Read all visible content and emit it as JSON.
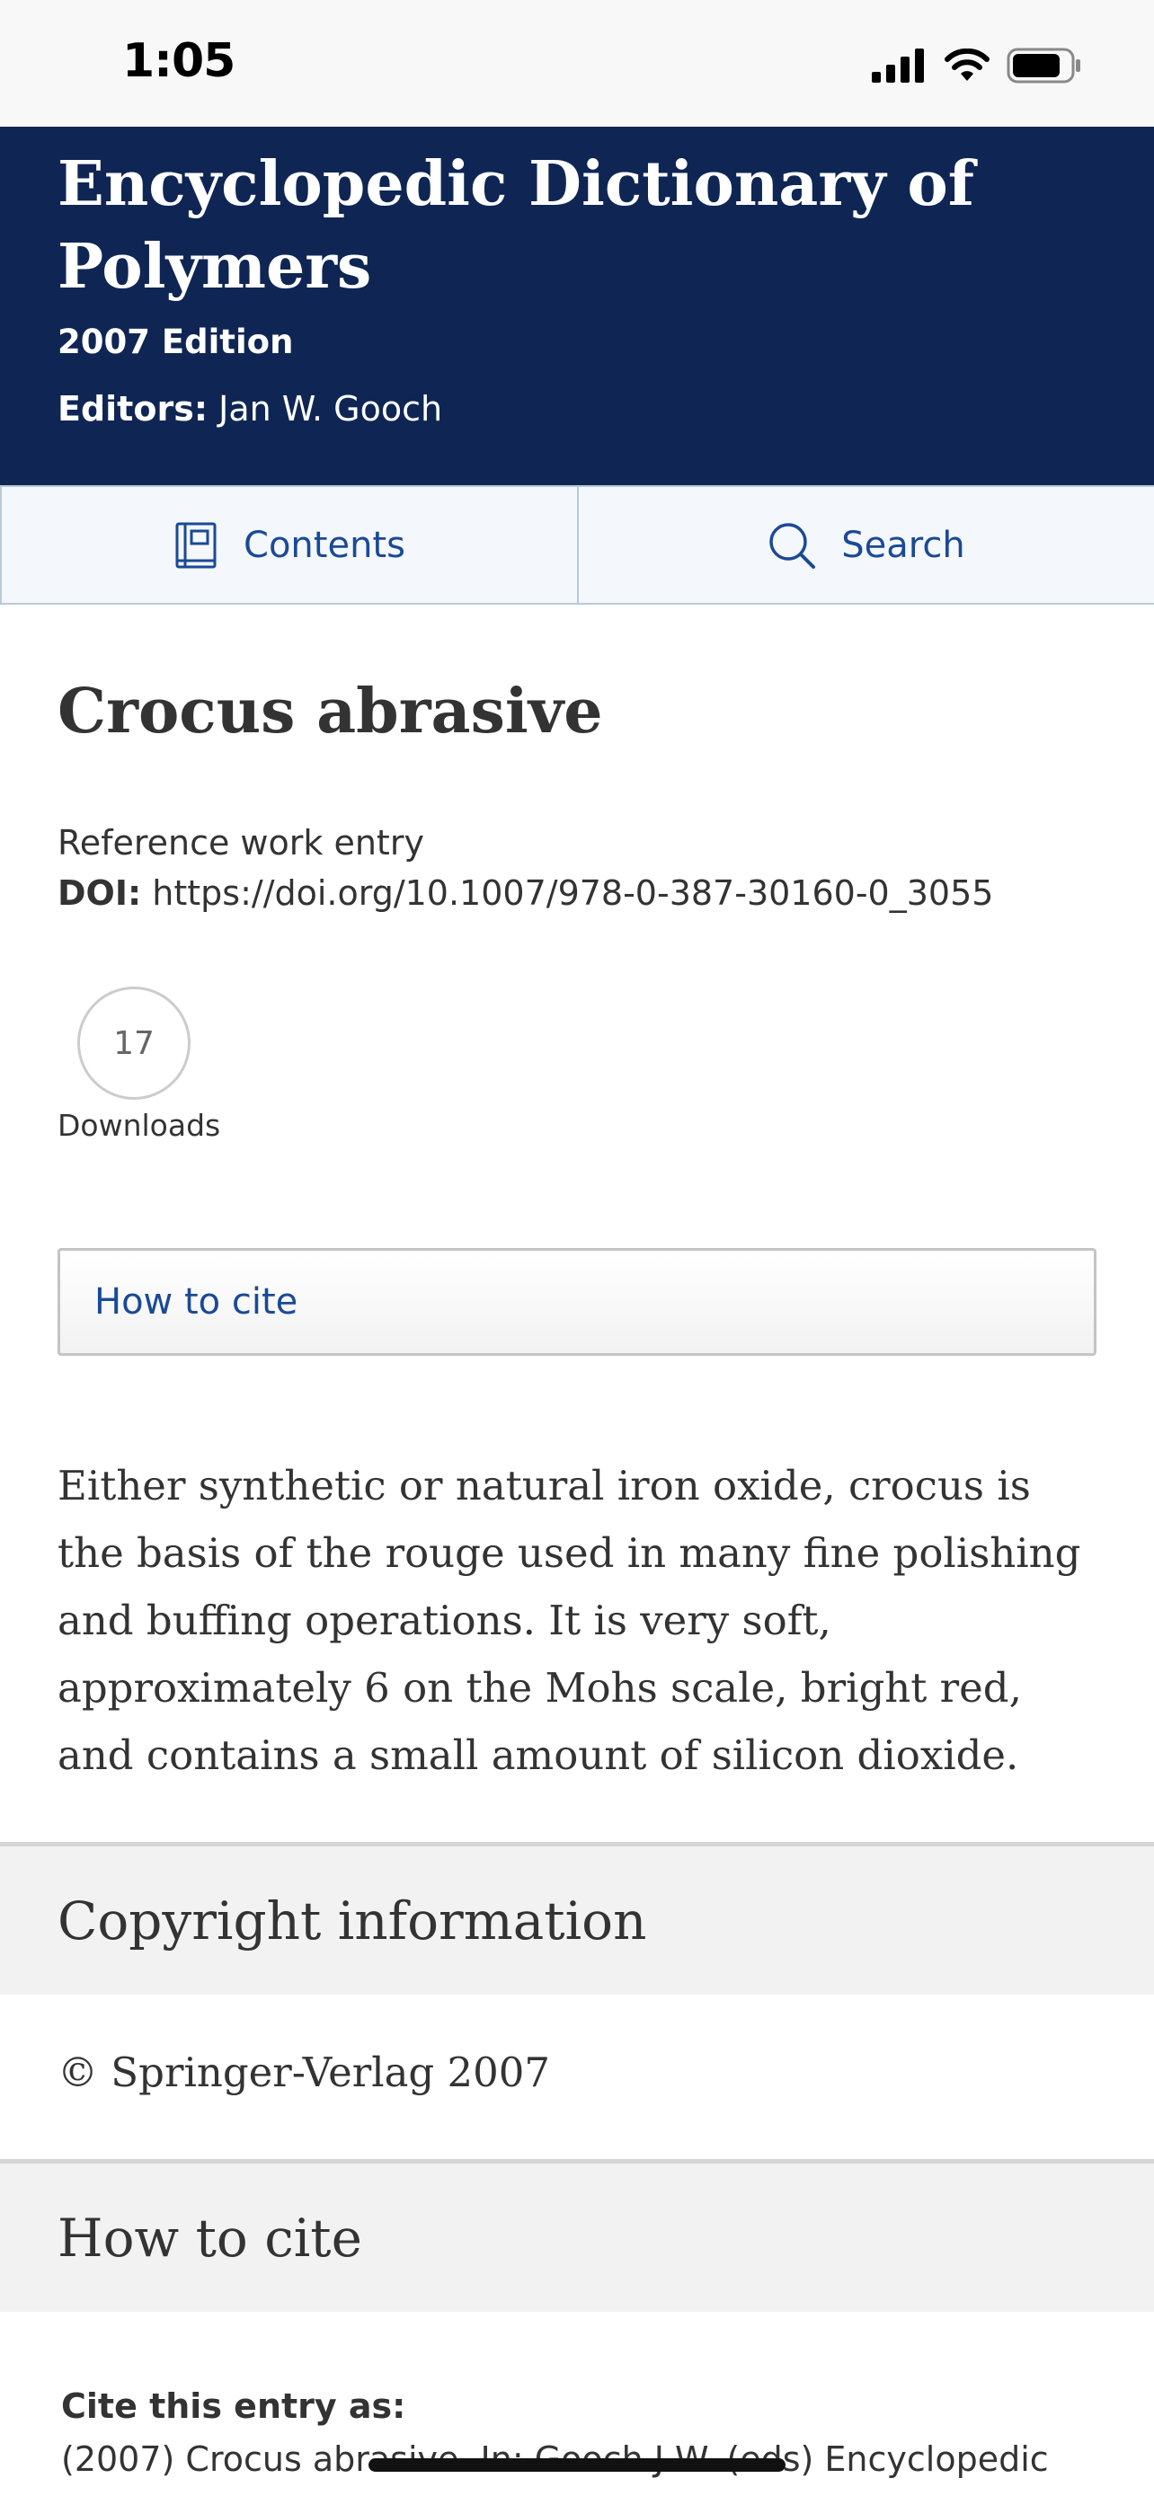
{
  "status_bar": {
    "time": "1:05",
    "icons": [
      "signal-icon",
      "wifi-icon",
      "battery-icon"
    ]
  },
  "header": {
    "title": "Encyclopedic Dictionary of Polymers",
    "edition": "2007 Edition",
    "editors_label": "Editors:",
    "editors_value": "Jan W. Gooch",
    "background_color": "#0f2654"
  },
  "tabs": [
    {
      "label": "Contents",
      "icon": "book-icon"
    },
    {
      "label": "Search",
      "icon": "search-icon"
    }
  ],
  "entry": {
    "title": "Crocus abrasive",
    "type": "Reference work entry",
    "doi_label": "DOI:",
    "doi_value": "https://doi.org/10.1007/978-0-387-30160-0_3055",
    "downloads_count": "17",
    "downloads_label": "Downloads",
    "how_to_cite_button": "How to cite",
    "definition": "Either synthetic or natural iron oxide, crocus is the basis of the rouge used in many fine polishing and buffing operations. It is very soft, approximately 6 on the Mohs scale, bright red, and contains a small amount of silicon dioxide."
  },
  "copyright_section": {
    "heading": "Copyright information",
    "text": "© Springer-Verlag 2007"
  },
  "cite_section": {
    "heading": "How to cite",
    "label": "Cite this entry as:",
    "text": "(2007) Crocus abrasive. In: Gooch J.W. (eds) Encyclopedic"
  },
  "colors": {
    "link": "#1a4a96",
    "section_background": "#f2f2f2"
  }
}
